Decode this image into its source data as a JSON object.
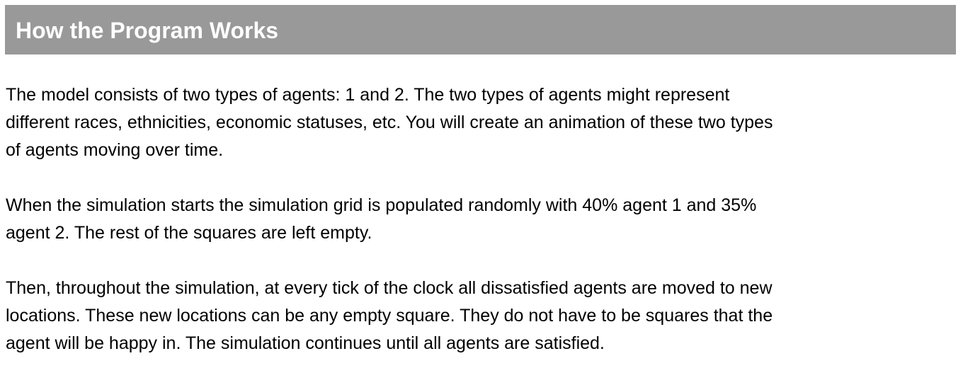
{
  "header": {
    "title": "How the Program Works",
    "background_color": "#999999"
  },
  "paragraphs": [
    {
      "lines": [
        "The model consists of two types of agents: 1 and 2. The two types of agents might represent",
        "different races, ethnicities, economic statuses, etc. You will create an animation of these two types",
        "of agents moving over time."
      ]
    },
    {
      "lines": [
        "When the simulation starts the simulation grid is populated randomly with 40% agent 1 and 35%",
        "agent 2. The rest of the squares are left empty."
      ]
    },
    {
      "lines": [
        "Then, throughout the simulation, at every tick of the clock all dissatisfied agents are moved to new",
        "locations. These new locations can be any empty square. They do not have to be squares that the",
        "agent will be happy in. The simulation continues until all agents are satisfied."
      ]
    }
  ]
}
